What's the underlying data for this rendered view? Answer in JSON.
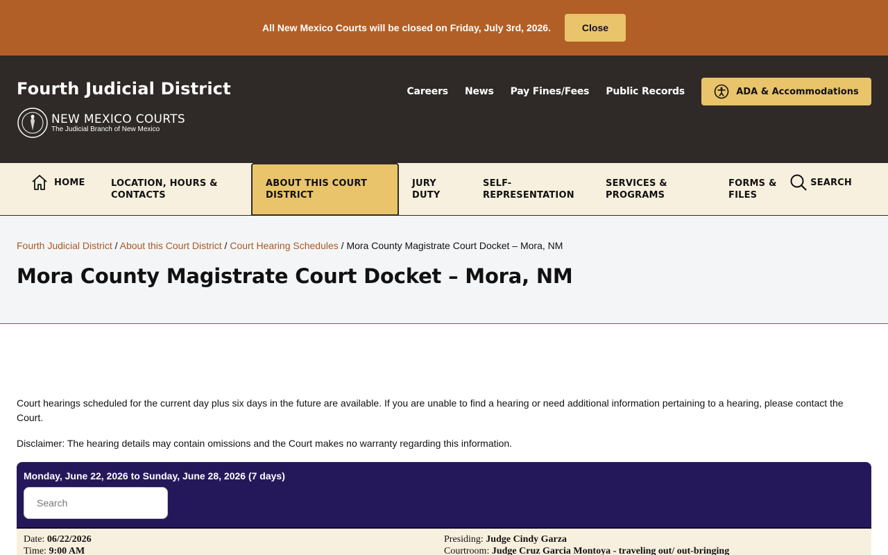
{
  "alert": {
    "text": "All New Mexico Courts will be closed on Friday, July 3rd, 2026.",
    "close_label": "Close"
  },
  "header": {
    "site_title": "Fourth Judicial District",
    "logo_main": "NEW MEXICO COURTS",
    "logo_sub": "The Judicial Branch of New Mexico",
    "utility_links": [
      "Careers",
      "News",
      "Pay Fines/Fees",
      "Public Records"
    ],
    "ada_label": "ADA & Accommodations"
  },
  "nav": {
    "home": "HOME",
    "location": "LOCATION, HOURS & CONTACTS",
    "about": "ABOUT THIS COURT DISTRICT",
    "jury": "JURY DUTY",
    "self_rep": "SELF-REPRESENTATION",
    "services": "SERVICES & PROGRAMS",
    "forms": "FORMS & FILES",
    "search": "SEARCH"
  },
  "breadcrumb": {
    "items": [
      "Fourth Judicial District",
      "About this Court District",
      "Court Hearing Schedules"
    ],
    "current": "Mora County Magistrate Court Docket – Mora, NM",
    "separator": " / "
  },
  "page_title": "Mora County Magistrate Court Docket – Mora, NM",
  "content": {
    "intro": "Court hearings scheduled for the current day plus six days in the future are available. If you are unable to find a hearing or need additional information pertaining to a hearing, please contact the Court.",
    "disclaimer": "Disclaimer:  The hearing details may contain omissions and the Court makes no warranty regarding this information."
  },
  "docket": {
    "range": "Monday, June 22, 2026 to Sunday, June 28, 2026 (7 days)",
    "search_placeholder": "Search",
    "record": {
      "date_label": "Date: ",
      "date_value": "06/22/2026",
      "time_label": "Time: ",
      "time_value": "9:00 AM",
      "presiding_label": "Presiding: ",
      "presiding_value": "Judge Cindy Garza",
      "courtroom_label": "Courtroom: ",
      "courtroom_value": "Judge Cruz Garcia Montoya - traveling out/ out-bringing"
    }
  },
  "colors": {
    "alert_bg": "#b25f27",
    "accent": "#e9c46a",
    "header_bg": "#2f2a27",
    "nav_bg": "#f8f0de",
    "docket_bg": "#25185a",
    "link": "#a65a24"
  }
}
